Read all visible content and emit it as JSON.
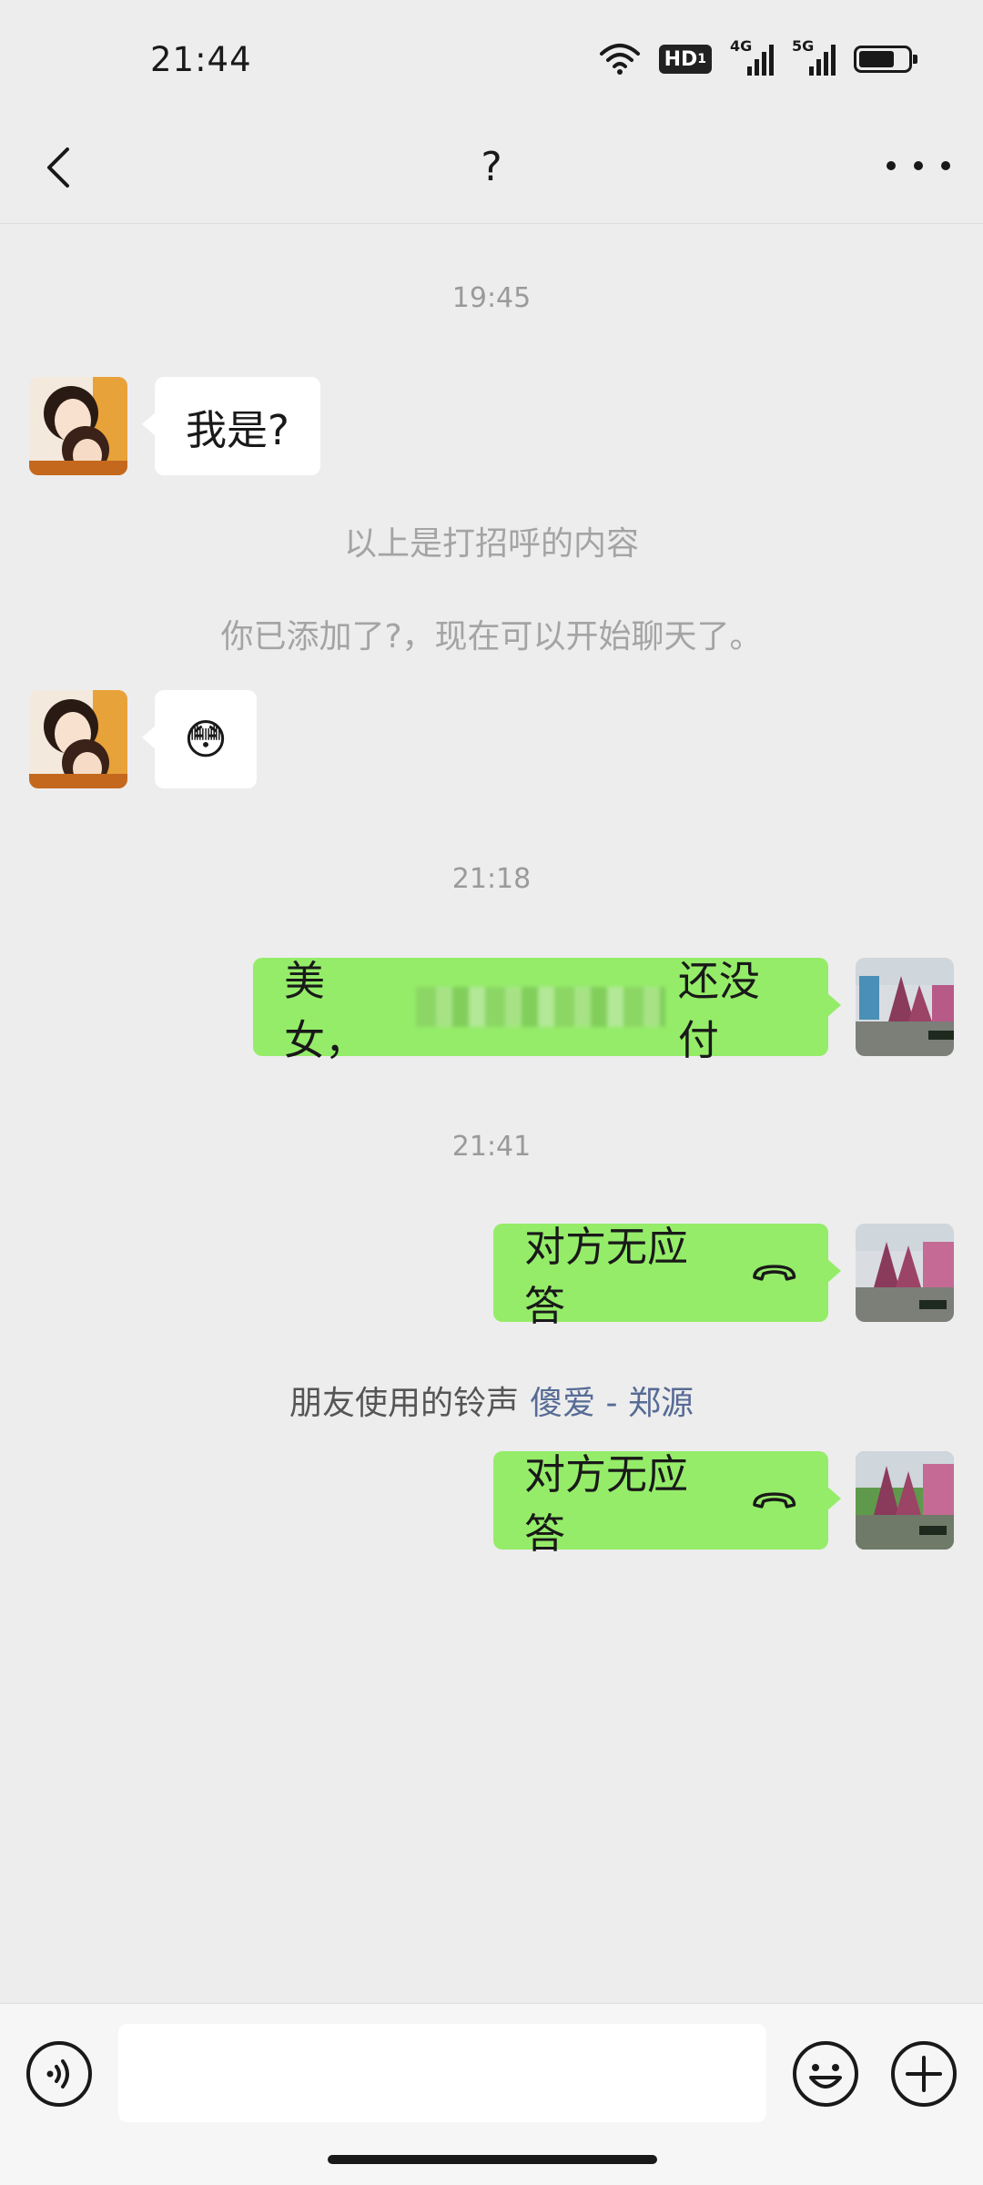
{
  "status_bar": {
    "time": "21:44",
    "hd_label": "HD",
    "hd_sub": "1",
    "sim1_label": "4G",
    "sim2_label": "5G",
    "battery_level": 0.75
  },
  "header": {
    "title": "?"
  },
  "messages": {
    "ts1": "19:45",
    "msg1": "我是?",
    "sys1": "以上是打招呼的内容",
    "sys2": "你已添加了?，现在可以开始聊天了。",
    "msg2_emoji": "😳",
    "ts2": "21:18",
    "msg3_prefix": "美女，",
    "msg3_suffix": "还没付",
    "ts3": "21:41",
    "call1": "对方无应答",
    "ringtone_label": "朋友使用的铃声",
    "ringtone_song": "傻爱 - 郑源",
    "call2": "对方无应答"
  },
  "input": {
    "value": "",
    "placeholder": ""
  },
  "colors": {
    "outgoing_bubble": "#95ec69",
    "incoming_bubble": "#ffffff",
    "background": "#ededed",
    "link": "#576b95"
  }
}
